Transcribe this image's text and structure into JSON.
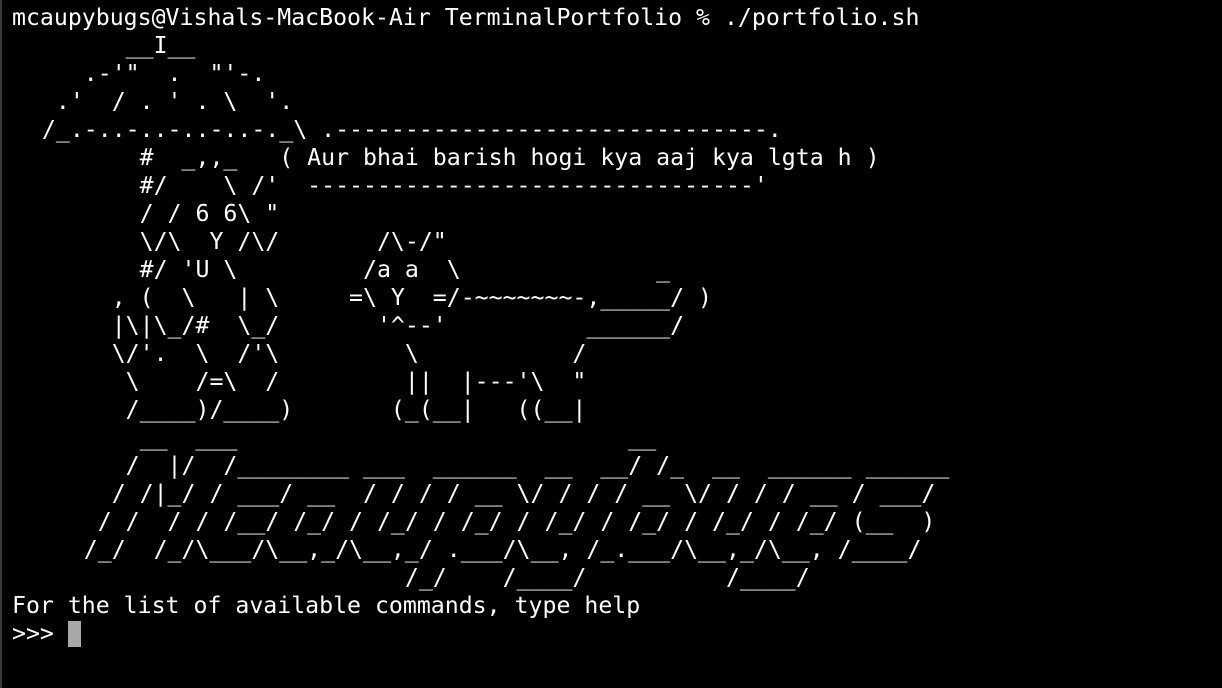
{
  "terminal": {
    "command_prompt": "mcaupybugs@Vishals-MacBook-Air TerminalPortfolio % ./portfolio.sh",
    "art_lines": [
      "        __I__",
      "     .-'\"  .  \"'-.",
      "   .'  / . ' . \\  '.",
      "  /_.-..-..-..-..-._\\ .-------------------------------.",
      "         #  _,,_   ( Aur bhai barish hogi kya aaj kya lgta h )",
      "         #/    \\ /'  --------------------------------'",
      "         / / 6 6\\ \"",
      "         \\/\\  Y /\\/       /\\-/\"",
      "         #/ 'U \\         /a a  \\              _",
      "       , (  \\   | \\     =\\ Y  =/-~~~~~~~-,_____/ )",
      "       |\\|\\_/#  \\_/       '^--'          ______/",
      "       \\/'.  \\  /'\\         \\           /",
      "        \\    /=\\  /         ||  |---'\\  \"",
      "        /____)/____)       (_(__|   ((__|",
      "         __  ___                            __",
      "        /  |/  /________ ___  ______  __  __/ /_  __  ______ ______",
      "       / /|_/ / ___/ __  / / / / __ \\/ / / / __ \\/ / / / __ / ___/",
      "      / /  / / /__/ /_/ / /_/ / /_/ / /_/ / /_/ / /_/ / /_/ (__  )",
      "     /_/  /_/\\___/\\__,_/\\__,_/ .___/\\__, /_.___/\\__,_/\\__, /____/",
      "                            /_/    /____/          /____/"
    ],
    "info_text": "For the list of available commands, type help",
    "prompt_symbol": ">>> "
  }
}
